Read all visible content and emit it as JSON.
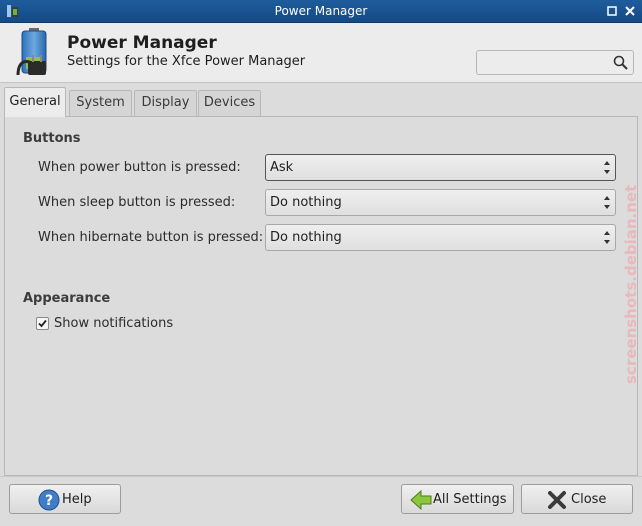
{
  "window": {
    "title": "Power Manager",
    "buttons": {
      "minimize": "◼",
      "close": "✕"
    }
  },
  "header": {
    "title": "Power Manager",
    "subtitle": "Settings for the Xfce Power Manager",
    "icon": "battery-plug-icon"
  },
  "search": {
    "value": "",
    "placeholder": ""
  },
  "tabs": [
    {
      "label": "General",
      "active": true
    },
    {
      "label": "System",
      "active": false
    },
    {
      "label": "Display",
      "active": false
    },
    {
      "label": "Devices",
      "active": false
    }
  ],
  "general": {
    "buttons_section": "Buttons",
    "rows": [
      {
        "label": "When power button is pressed:",
        "value": "Ask"
      },
      {
        "label": "When sleep button is pressed:",
        "value": "Do nothing"
      },
      {
        "label": "When hibernate button is pressed:",
        "value": "Do nothing"
      }
    ],
    "appearance_section": "Appearance",
    "show_notifications": {
      "label": "Show notifications",
      "checked": true
    }
  },
  "watermark": "screenshots.debian.net",
  "footer": {
    "help": "Help",
    "all_settings": "All Settings",
    "close": "Close"
  },
  "colors": {
    "titlebar": "#1f5c9c",
    "window_bg": "#dcdcdc",
    "watermark": "#e8b8bc"
  }
}
